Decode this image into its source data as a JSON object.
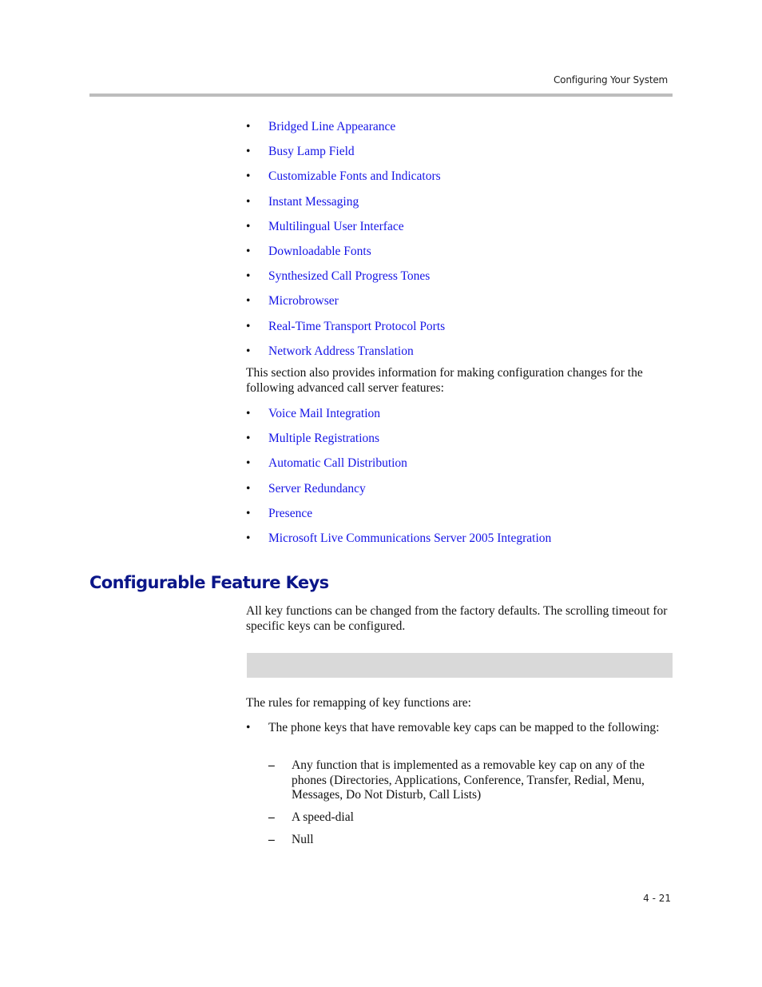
{
  "header": {
    "title": "Configuring Your System"
  },
  "feature_links": [
    {
      "bullet": "•",
      "label": "Bridged Line Appearance"
    },
    {
      "bullet": "•",
      "label": "Busy Lamp Field"
    },
    {
      "bullet": "•",
      "label": "Customizable Fonts and Indicators"
    },
    {
      "bullet": "•",
      "label": "Instant Messaging"
    },
    {
      "bullet": "•",
      "label": "Multilingual User Interface"
    },
    {
      "bullet": "•",
      "label": "Downloadable Fonts"
    },
    {
      "bullet": "•",
      "label": "Synthesized Call Progress Tones"
    },
    {
      "bullet": "•",
      "label": "Microbrowser"
    },
    {
      "bullet": "•",
      "label": "Real-Time Transport Protocol Ports"
    },
    {
      "bullet": "•",
      "label": "Network Address Translation"
    }
  ],
  "intro2": "This section also provides information for making configuration changes for the following advanced call server features:",
  "server_feature_links": [
    {
      "bullet": "•",
      "label": "Voice Mail Integration"
    },
    {
      "bullet": "•",
      "label": "Multiple Registrations"
    },
    {
      "bullet": "•",
      "label": "Automatic Call Distribution"
    },
    {
      "bullet": "•",
      "label": "Server Redundancy"
    },
    {
      "bullet": "•",
      "label": "Presence"
    },
    {
      "bullet": "•",
      "label": "Microsoft Live Communications Server 2005 Integration"
    }
  ],
  "section": {
    "heading": "Configurable Feature Keys",
    "paragraph": "All key functions can be changed from the factory defaults. The scrolling timeout for specific keys can be configured.",
    "rules_intro": "The rules for remapping of key functions are:",
    "rule": {
      "bullet": "•",
      "text": "The phone keys that have removable key caps can be mapped to the following:",
      "sub_items": [
        {
          "dash": "–",
          "text": "Any function that is implemented as a removable key cap on any of the phones (Directories, Applications, Conference, Transfer, Redial, Menu, Messages, Do Not Disturb, Call Lists)"
        },
        {
          "dash": "–",
          "text": "A speed-dial"
        },
        {
          "dash": "–",
          "text": "Null"
        }
      ]
    }
  },
  "footer": {
    "page_number": "4 - 21"
  },
  "colors": {
    "link": "#1515e6",
    "heading": "#0b1689",
    "rule": "#bdbdbd",
    "note_bar": "#d9d9d9"
  }
}
